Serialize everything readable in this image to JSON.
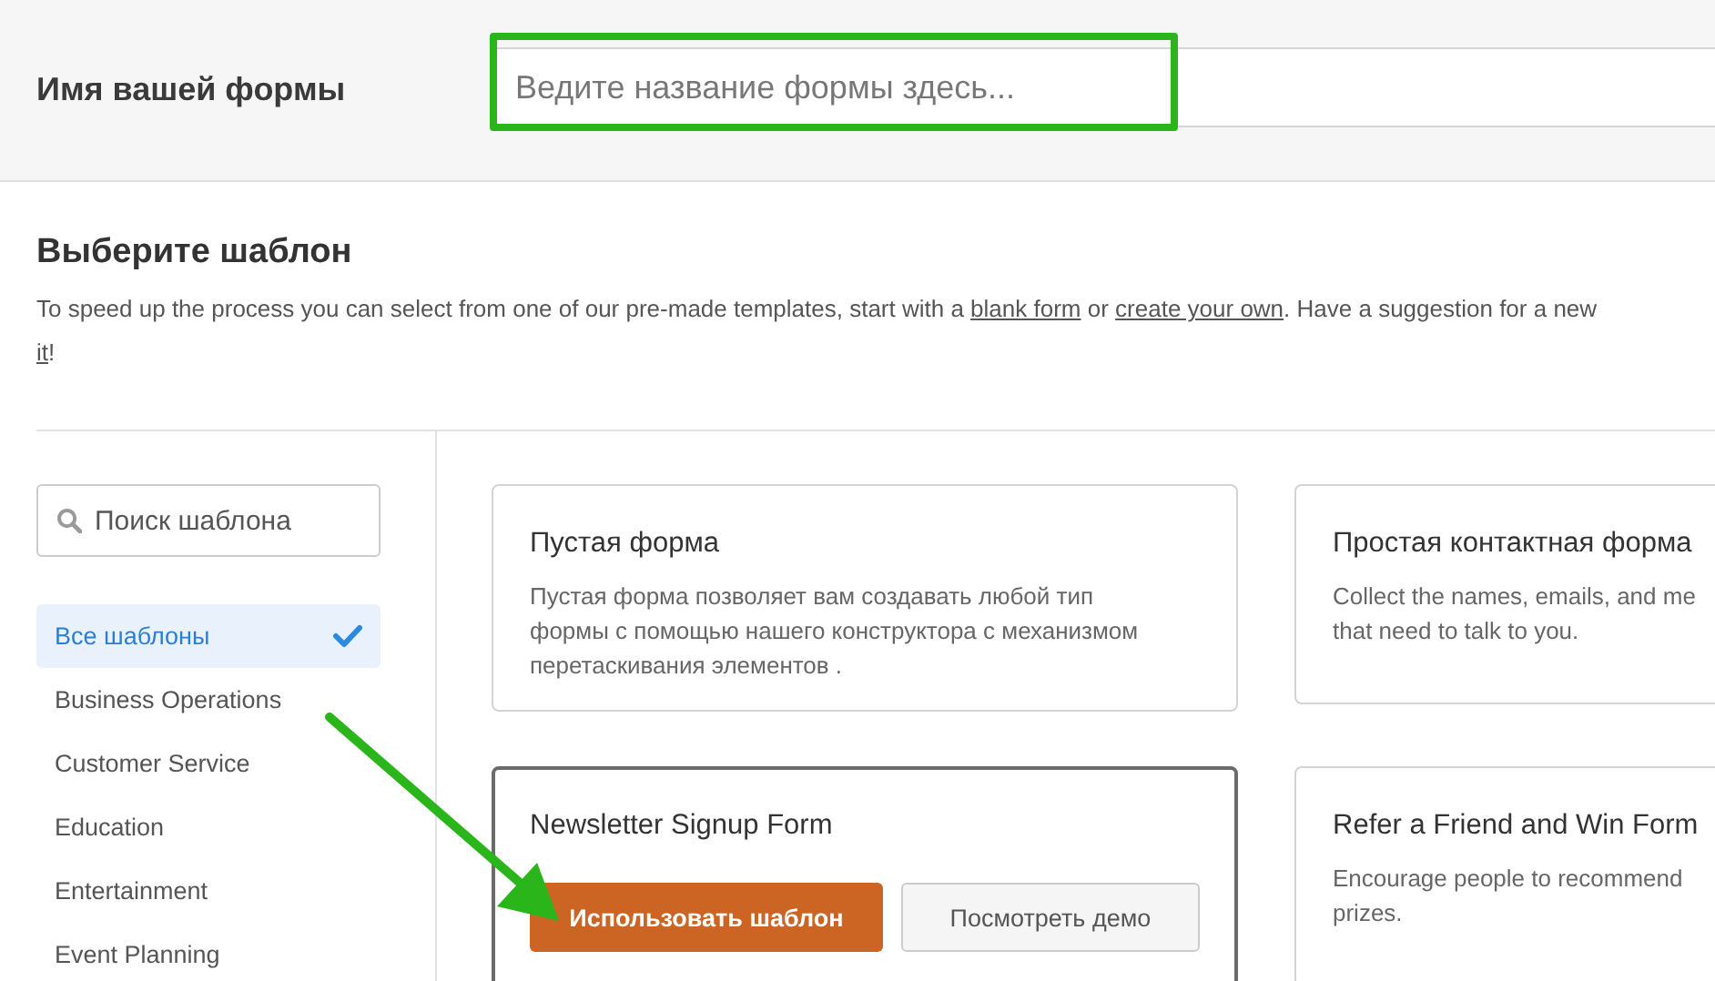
{
  "header": {
    "label": "Имя вашей формы",
    "name_field": {
      "placeholder": "Ведите название формы здесь..."
    }
  },
  "section": {
    "title": "Выберите шаблон",
    "intro": [
      {
        "kind": "text",
        "text": "To speed up the process you can select from one of our pre-made templates, start with a"
      },
      {
        "kind": "link",
        "text": "blank form"
      },
      {
        "kind": "text",
        "text": "or"
      },
      {
        "kind": "link",
        "text": "create your own"
      },
      {
        "kind": "text",
        "text": ". Have a suggestion for a new"
      },
      {
        "kind": "break"
      },
      {
        "kind": "link",
        "text": "it"
      },
      {
        "kind": "text",
        "text": "!"
      }
    ]
  },
  "sidebar": {
    "search": {
      "placeholder": "Поиск шаблона"
    },
    "items": [
      {
        "label": "Все шаблоны",
        "selected": true
      },
      {
        "label": "Business Operations",
        "selected": false
      },
      {
        "label": "Customer Service",
        "selected": false
      },
      {
        "label": "Education",
        "selected": false
      },
      {
        "label": "Entertainment",
        "selected": false
      },
      {
        "label": "Event Planning",
        "selected": false
      }
    ]
  },
  "templates": [
    {
      "title": "Пустая форма",
      "description": "Пустая форма позволяет вам создавать любой тип формы с помощью нашего конструктора с механизмом перетаскивания элементов .",
      "hovered": false
    },
    {
      "title": "Простая контактная форма",
      "description": "Collect the names, emails, and me\nthat need to talk to you.",
      "hovered": false
    },
    {
      "title": "Newsletter Signup Form",
      "hovered": true,
      "use_button": "Использовать шаблон",
      "demo_button": "Посмотреть демо"
    },
    {
      "title": "Refer a Friend and Win Form",
      "description": "Encourage people to recommend\nprizes.",
      "hovered": false
    }
  ],
  "annotations": {
    "highlight_frame": true,
    "arrow": true
  }
}
